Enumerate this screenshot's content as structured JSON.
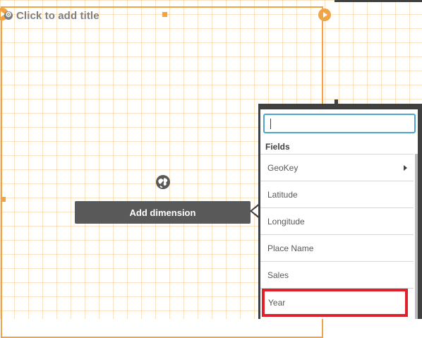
{
  "title": {
    "placeholder": "Click to add title",
    "icon": "gear-icon"
  },
  "dimension_button": {
    "label": "Add dimension",
    "icon": "globe-icon"
  },
  "fields_panel": {
    "search_value": "",
    "header": "Fields",
    "items": [
      {
        "label": "GeoKey",
        "has_submenu": true
      },
      {
        "label": "Latitude",
        "has_submenu": false
      },
      {
        "label": "Longitude",
        "has_submenu": false
      },
      {
        "label": "Place Name",
        "has_submenu": false
      },
      {
        "label": "Sales",
        "has_submenu": false
      },
      {
        "label": "Year",
        "has_submenu": false,
        "highlighted": true
      }
    ]
  },
  "colors": {
    "selection_orange": "#f0a445",
    "grid_orange": "#f4b260",
    "panel_dark": "#404040",
    "button_dark_gray": "#595959",
    "search_focus_blue": "#4ea4c9",
    "highlight_red": "#e0202a"
  }
}
